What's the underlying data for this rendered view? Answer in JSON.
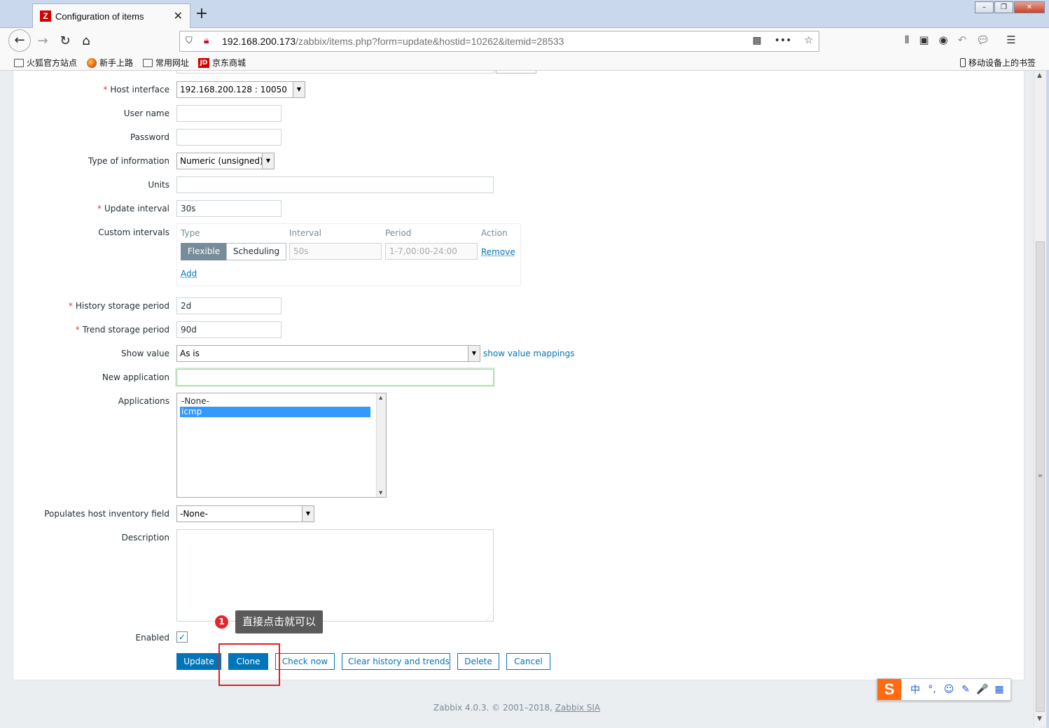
{
  "browser": {
    "tab_title": "Configuration of items",
    "tab_favicon": "Z",
    "new_tab": "+",
    "url_host": "192.168.200.173",
    "url_path": "/zabbix/items.php?form=update&hostid=10262&itemid=28533",
    "bookmarks": [
      "火狐官方站点",
      "新手上路",
      "常用网址",
      "京东商城"
    ],
    "bookmark_jd_badge": "JD",
    "mobile_bookmarks": "移动设备上的书签"
  },
  "form": {
    "host_interface": {
      "label": "Host interface",
      "value": "192.168.200.128 : 10050"
    },
    "user_name": {
      "label": "User name",
      "value": ""
    },
    "password": {
      "label": "Password",
      "value": ""
    },
    "type_of_information": {
      "label": "Type of information",
      "value": "Numeric (unsigned)"
    },
    "units": {
      "label": "Units",
      "value": ""
    },
    "update_interval": {
      "label": "Update interval",
      "value": "30s"
    },
    "custom_intervals": {
      "label": "Custom intervals",
      "headers": [
        "Type",
        "Interval",
        "Period",
        "Action"
      ],
      "type_options": [
        "Flexible",
        "Scheduling"
      ],
      "interval_placeholder": "50s",
      "period_placeholder": "1-7,00:00-24:00",
      "remove": "Remove",
      "add": "Add"
    },
    "history": {
      "label": "History storage period",
      "value": "2d"
    },
    "trends": {
      "label": "Trend storage period",
      "value": "90d"
    },
    "show_value": {
      "label": "Show value",
      "value": "As is",
      "link": "show value mappings"
    },
    "new_application": {
      "label": "New application",
      "value": ""
    },
    "applications": {
      "label": "Applications",
      "options": [
        "-None-",
        "icmp"
      ],
      "selected": "icmp"
    },
    "inventory": {
      "label": "Populates host inventory field",
      "value": "-None-"
    },
    "description": {
      "label": "Description",
      "value": ""
    },
    "enabled": {
      "label": "Enabled",
      "checked": true
    }
  },
  "buttons": {
    "update": "Update",
    "clone": "Clone",
    "check_now": "Check now",
    "clear": "Clear history and trends",
    "delete": "Delete",
    "cancel": "Cancel"
  },
  "annotation": {
    "number": "1",
    "text": "直接点击就可以"
  },
  "footer": {
    "text": "Zabbix 4.0.3. © 2001–2018, ",
    "link": "Zabbix SIA"
  },
  "ime": {
    "logo": "S",
    "items": [
      "中",
      "°,",
      "☺",
      "✎",
      "🎤",
      "▦"
    ]
  },
  "colors": {
    "accent": "#0275b8",
    "required": "#e33734",
    "highlight": "#e02020"
  }
}
